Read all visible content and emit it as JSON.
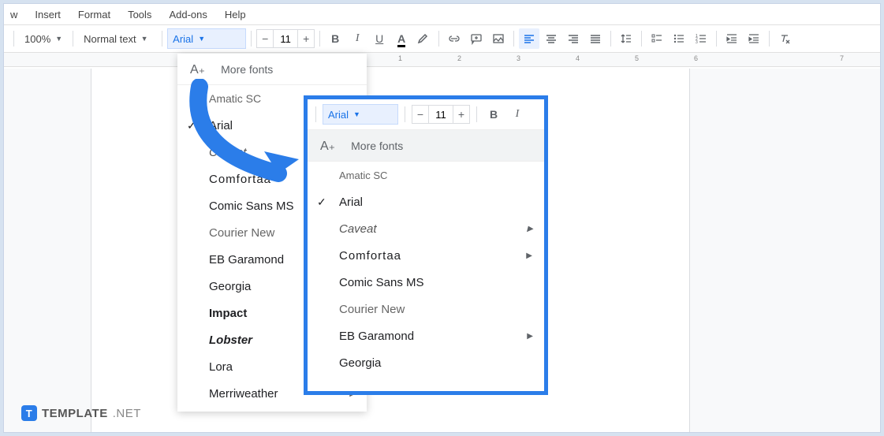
{
  "menu": {
    "items": [
      "w",
      "Insert",
      "Format",
      "Tools",
      "Add-ons",
      "Help"
    ]
  },
  "toolbar": {
    "zoom": "100%",
    "style": "Normal text",
    "font": "Arial",
    "fontsize": "11"
  },
  "dropdown": {
    "more_fonts": "More fonts",
    "fonts": [
      {
        "label": "Amatic SC",
        "family": "cursive",
        "style": "font-family:'Brush Script MT',cursive;font-size:14px;color:#666"
      },
      {
        "label": "Arial",
        "checked": true,
        "style": "font-family:Arial"
      },
      {
        "label": "Caveat",
        "arrow": true,
        "style": "font-family:'Brush Script MT',cursive;font-style:italic;color:#555"
      },
      {
        "label": "Comfortaa",
        "arrow": true,
        "style": "font-family:Arial;letter-spacing:1px"
      },
      {
        "label": "Comic Sans MS",
        "style": "font-family:'Comic Sans MS',cursive"
      },
      {
        "label": "Courier New",
        "style": "font-family:'Courier New',monospace;color:#666"
      },
      {
        "label": "EB Garamond",
        "arrow": true,
        "style": "font-family:Georgia,serif"
      },
      {
        "label": "Georgia",
        "style": "font-family:Georgia,serif"
      },
      {
        "label": "Impact",
        "style": "font-family:Impact,sans-serif;font-weight:bold"
      },
      {
        "label": "Lobster",
        "style": "font-family:'Brush Script MT',cursive;font-weight:bold;font-style:italic"
      },
      {
        "label": "Lora",
        "arrow": true,
        "style": "font-family:Georgia,serif"
      },
      {
        "label": "Merriweather",
        "arrow": true,
        "style": "font-family:Georgia,serif"
      }
    ]
  },
  "callout": {
    "font": "Arial",
    "fontsize": "11",
    "more_fonts": "More fonts",
    "fonts": [
      {
        "label": "Amatic SC",
        "style": "font-family:'Brush Script MT',cursive;font-size:13px;color:#666"
      },
      {
        "label": "Arial",
        "checked": true,
        "style": "font-family:Arial"
      },
      {
        "label": "Caveat",
        "arrow": true,
        "style": "font-family:'Brush Script MT',cursive;font-style:italic;color:#555"
      },
      {
        "label": "Comfortaa",
        "arrow": true,
        "style": "font-family:Arial;letter-spacing:1px"
      },
      {
        "label": "Comic Sans MS",
        "style": "font-family:'Comic Sans MS',cursive"
      },
      {
        "label": "Courier New",
        "style": "font-family:'Courier New',monospace;color:#666"
      },
      {
        "label": "EB Garamond",
        "arrow": true,
        "style": "font-family:Georgia,serif"
      },
      {
        "label": "Georgia",
        "style": "font-family:Georgia,serif"
      }
    ]
  },
  "logo": {
    "brand": "TEMPLATE",
    "suffix": ".NET"
  }
}
